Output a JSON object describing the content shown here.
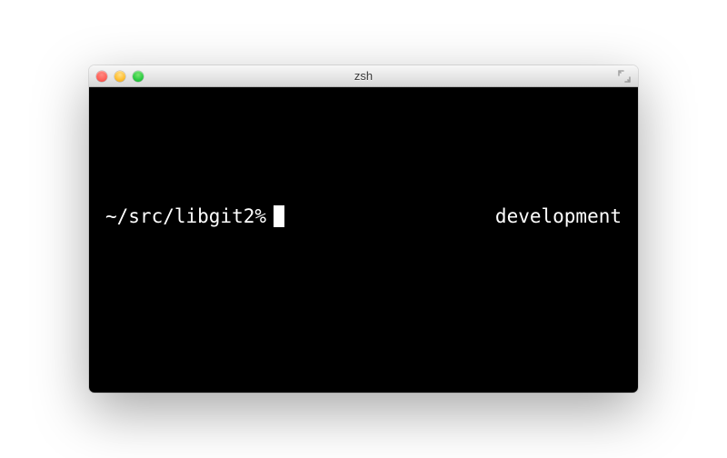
{
  "window": {
    "title": "zsh"
  },
  "terminal": {
    "prompt_left": "~/src/libgit2%",
    "prompt_right": "development"
  }
}
